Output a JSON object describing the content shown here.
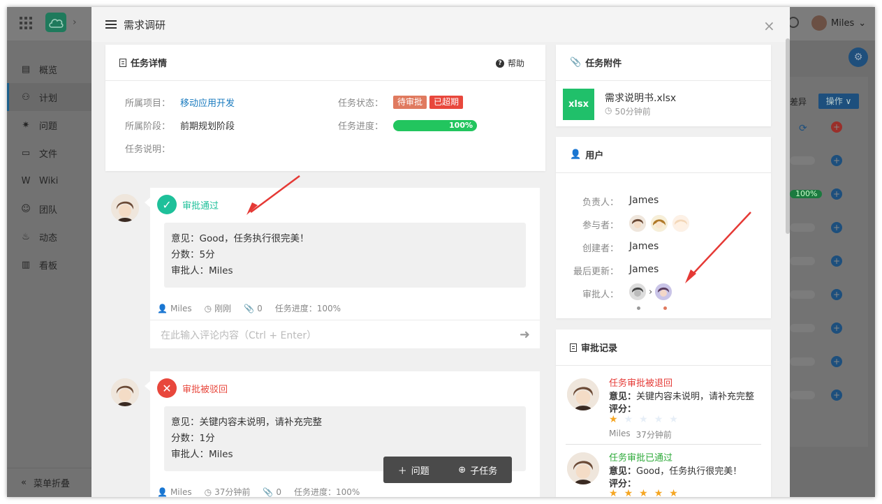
{
  "background": {
    "sidebar": [
      {
        "label": "概览",
        "icon": "overview-icon"
      },
      {
        "label": "计划",
        "icon": "plan-icon"
      },
      {
        "label": "问题",
        "icon": "issue-icon"
      },
      {
        "label": "文件",
        "icon": "folder-icon"
      },
      {
        "label": "Wiki",
        "icon": "wiki-icon"
      },
      {
        "label": "团队",
        "icon": "team-icon"
      },
      {
        "label": "动态",
        "icon": "activity-icon"
      },
      {
        "label": "看板",
        "icon": "board-icon"
      }
    ],
    "collapse_label": "菜单折叠",
    "user_name": "Miles",
    "ops_label": "操作 ∨",
    "diff_label": "差异",
    "progress_label": "100%"
  },
  "modal": {
    "title": "需求调研",
    "close": "×",
    "task_detail": {
      "heading": "任务详情",
      "help": "帮助",
      "project_label": "所属项目：",
      "project_value": "移动应用开发",
      "stage_label": "所属阶段：",
      "stage_value": "前期规划阶段",
      "desc_label": "任务说明：",
      "status_label": "任务状态：",
      "status_badges": [
        "待审批",
        "已超期"
      ],
      "progress_label": "任务进度：",
      "progress_value": "100%"
    },
    "activities": [
      {
        "status": "审批通过",
        "opinion": "意见：Good，任务执行很完美！",
        "score": "分数：5分",
        "approver": "审批人：Miles",
        "user": "Miles",
        "time": "刚刚",
        "attachments": "0",
        "progress": "任务进度：100%",
        "comment_placeholder": "在此输入评论内容（Ctrl + Enter）"
      },
      {
        "status": "审批被驳回",
        "opinion": "意见：关键内容未说明，请补充完整",
        "score": "分数：1分",
        "approver": "审批人：Miles",
        "user": "Miles",
        "time": "37分钟前",
        "attachments": "0",
        "progress": "任务进度：100%"
      }
    ],
    "float_bar": {
      "issue": "问题",
      "subtask": "子任务"
    },
    "attachments": {
      "heading": "任务附件",
      "file_name": "需求说明书.xlsx",
      "file_type": "xlsx",
      "file_time": "50分钟前"
    },
    "users": {
      "heading": "用户",
      "owner_label": "负责人：",
      "owner": "James",
      "participants_label": "参与者：",
      "creator_label": "创建者：",
      "creator": "James",
      "updater_label": "最后更新：",
      "updater": "James",
      "approver_label": "审批人："
    },
    "approval_log": {
      "heading": "审批记录",
      "entries": [
        {
          "status": "任务审批被退回",
          "opinion_label": "意见：",
          "opinion": "关键内容未说明，请补充完整",
          "score_label": "评分：",
          "stars": 1,
          "user": "Miles",
          "time": "37分钟前",
          "color": "#e53935"
        },
        {
          "status": "任务审批已通过",
          "opinion_label": "意见：",
          "opinion": "Good，任务执行很完美！",
          "score_label": "评分：",
          "stars": 5,
          "color": "#2eaa3a"
        }
      ]
    }
  },
  "colors": {
    "approve": "#1ec09a",
    "reject": "#e8473c",
    "pending_badge": "#e07a5f",
    "overdue_badge": "#e8473c",
    "link": "#1a7bbf",
    "progress": "#22c55e",
    "star": "#f5a623"
  }
}
